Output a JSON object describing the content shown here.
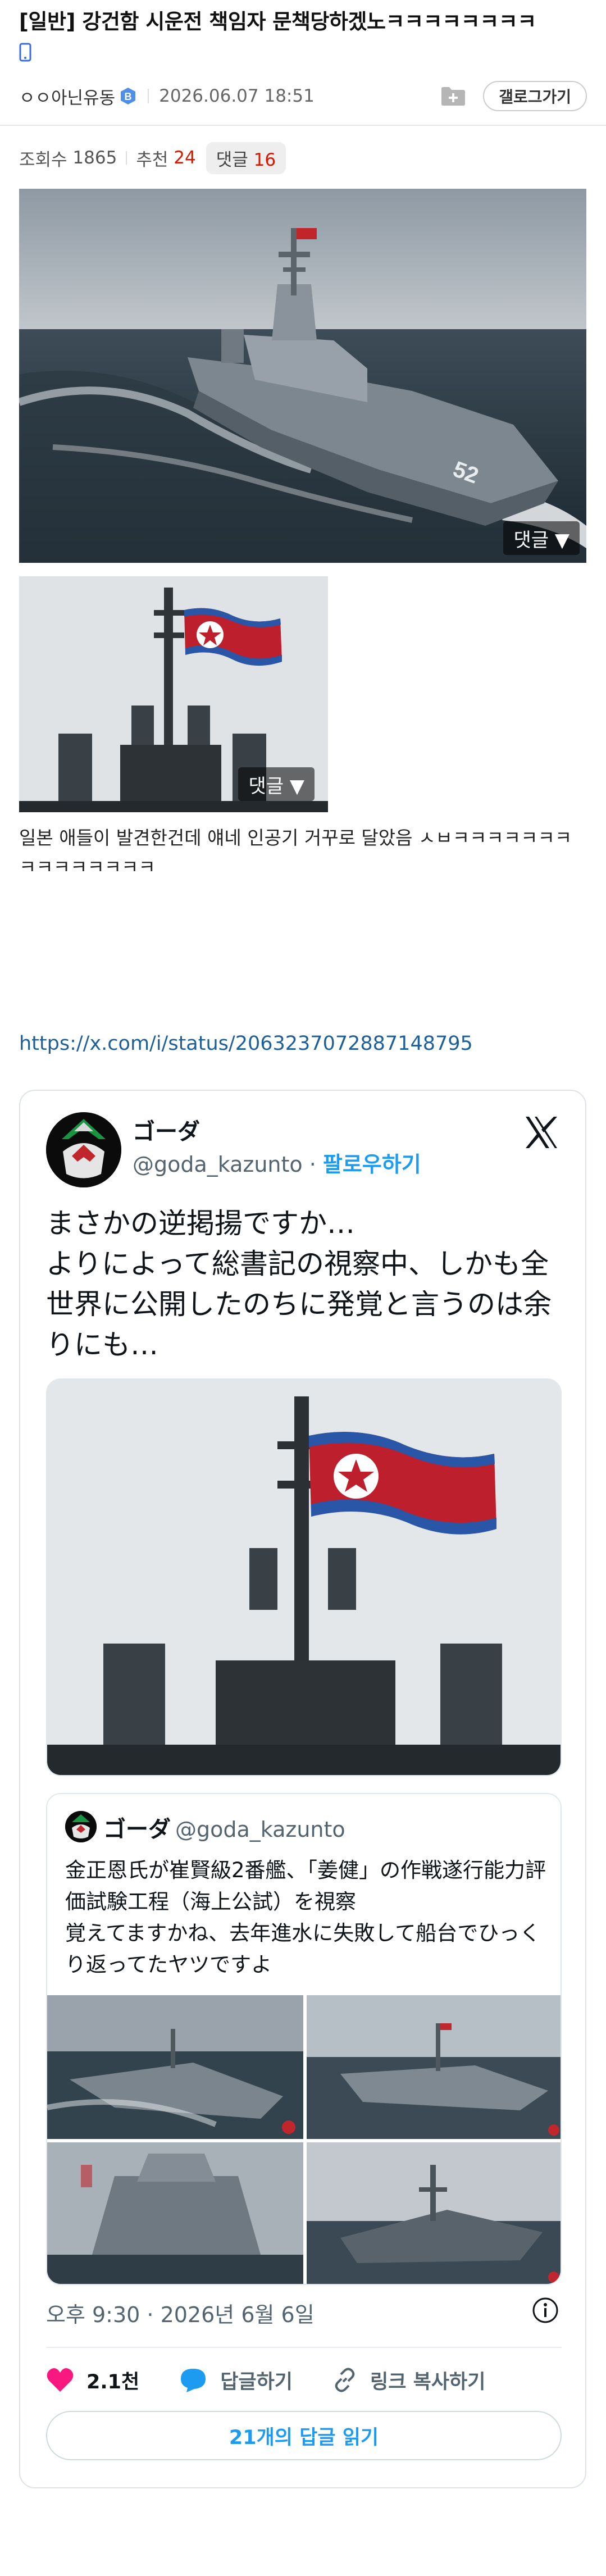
{
  "post": {
    "title": "[일반] 강건함 시운전 책임자 문책당하겠노ㅋㅋㅋㅋㅋㅋㅋㅋ",
    "author": "ㅇㅇ아닌유동",
    "author_badge": "B",
    "date": "2026.06.07 18:51",
    "gallery_button": "갤로그가기"
  },
  "stats": {
    "views_label": "조회수",
    "views": "1865",
    "recommend_label": "추천",
    "recommend": "24",
    "comments_label": "댓글",
    "comments": "16"
  },
  "images": {
    "comment_overlay": "댓글 ▼"
  },
  "body": {
    "text": "일본 애들이 발견한건데 얘네 인공기 거꾸로 달았음 ㅅㅂㅋㅋㅋㅋㅋㅋㅋㅋㅋㅋㅋㅋㅋㅋㅋ",
    "link": "https://x.com/i/status/2063237072887148795"
  },
  "tweet": {
    "name": "ゴーダ",
    "handle": "@goda_kazunto",
    "dot": " · ",
    "follow": "팔로우하기",
    "text": "まさかの逆掲揚ですか…\nよりによって総書記の視察中、しかも全世界に公開したのちに発覚と言うのは余りにも…",
    "quote": {
      "name": "ゴーダ",
      "handle": "@goda_kazunto",
      "text": "金正恩氏が崔賢級2番艦、「姜健」の作戦遂行能力評価試験工程（海上公試）を視察\n覚えてますかね、去年進水に失敗して船台でひっくり返ってたヤツですよ"
    },
    "time": "오후 9:30 · 2026년 6월 6일",
    "likes": "2.1천",
    "reply": "답글하기",
    "copy_link": "링크 복사하기",
    "read_replies": "21개의 답글 읽기"
  },
  "colors": {
    "accent_red": "#d31900",
    "link_blue": "#1e5f9a",
    "twitter_blue": "#1d9bf0",
    "like_pink": "#f91880"
  },
  "icons": [
    "phone-icon",
    "badge-b-icon",
    "folder-plus-icon",
    "x-logo-icon",
    "info-icon",
    "heart-icon",
    "reply-bubble-icon",
    "link-icon"
  ]
}
